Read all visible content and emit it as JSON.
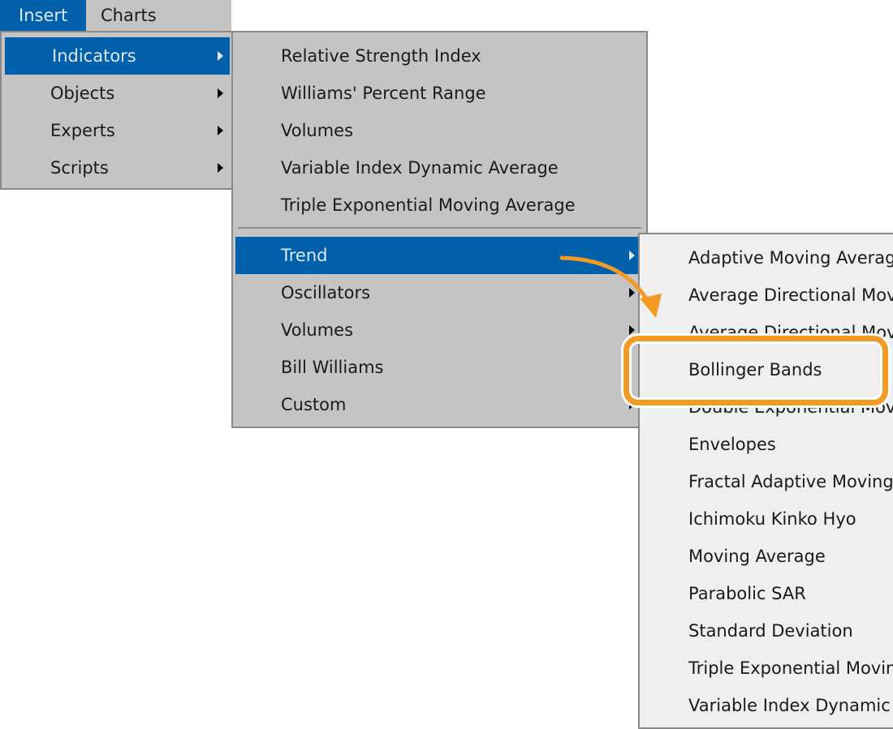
{
  "menubar": {
    "items": [
      {
        "label": "Insert",
        "active": true
      },
      {
        "label": "Charts",
        "active": false
      }
    ]
  },
  "insert_menu": {
    "items": [
      {
        "label": "Indicators",
        "submenu": true,
        "highlighted": true
      },
      {
        "label": "Objects",
        "submenu": true
      },
      {
        "label": "Experts",
        "submenu": true
      },
      {
        "label": "Scripts",
        "submenu": true
      }
    ]
  },
  "indicators_menu": {
    "recent": [
      "Relative Strength Index",
      "Williams' Percent Range",
      "Volumes",
      "Variable Index Dynamic Average",
      "Triple Exponential Moving Average"
    ],
    "groups": [
      {
        "label": "Trend",
        "submenu": true,
        "highlighted": true
      },
      {
        "label": "Oscillators",
        "submenu": true
      },
      {
        "label": "Volumes",
        "submenu": true
      },
      {
        "label": "Bill Williams",
        "submenu": false
      },
      {
        "label": "Custom",
        "submenu": true
      }
    ]
  },
  "trend_menu": {
    "items": [
      "Adaptive Moving Average",
      "Average Directional Movement Index",
      "Average Directional Movement Index Wilder",
      "Bollinger Bands",
      "Double Exponential Moving Average",
      "Envelopes",
      "Fractal Adaptive Moving Average",
      "Ichimoku Kinko Hyo",
      "Moving Average",
      "Parabolic SAR",
      "Standard Deviation",
      "Triple Exponential Moving Average",
      "Variable Index Dynamic Average"
    ]
  },
  "annotation": {
    "highlighted_item": "Bollinger Bands",
    "color": "#f29a24"
  }
}
